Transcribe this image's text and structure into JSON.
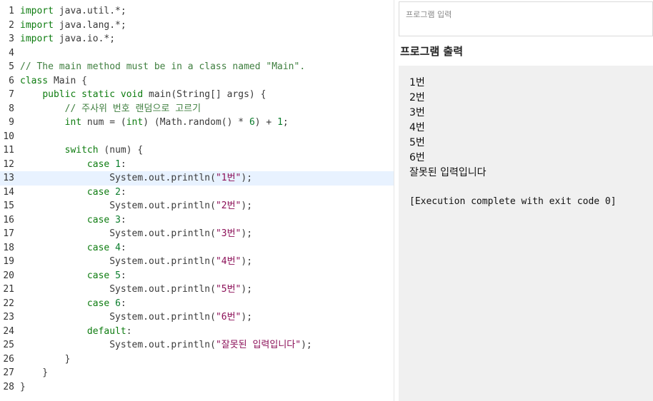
{
  "editor": {
    "active_line": 13,
    "lines": [
      {
        "n": "1",
        "tokens": [
          {
            "t": "kw",
            "v": "import"
          },
          {
            "t": "p",
            "v": " java.util.*;"
          }
        ]
      },
      {
        "n": "2",
        "tokens": [
          {
            "t": "kw",
            "v": "import"
          },
          {
            "t": "p",
            "v": " java.lang.*;"
          }
        ]
      },
      {
        "n": "3",
        "tokens": [
          {
            "t": "kw",
            "v": "import"
          },
          {
            "t": "p",
            "v": " java.io.*;"
          }
        ]
      },
      {
        "n": "4",
        "tokens": []
      },
      {
        "n": "5",
        "tokens": [
          {
            "t": "cm",
            "v": "// The main method must be in a class named \"Main\"."
          }
        ]
      },
      {
        "n": "6",
        "tokens": [
          {
            "t": "kw",
            "v": "class"
          },
          {
            "t": "p",
            "v": " Main {"
          }
        ]
      },
      {
        "n": "7",
        "tokens": [
          {
            "t": "p",
            "v": "    "
          },
          {
            "t": "kw",
            "v": "public static void"
          },
          {
            "t": "p",
            "v": " main(String[] args) {"
          }
        ]
      },
      {
        "n": "8",
        "tokens": [
          {
            "t": "p",
            "v": "        "
          },
          {
            "t": "cm",
            "v": "// 주사위 번호 랜덤으로 고르기"
          }
        ]
      },
      {
        "n": "9",
        "tokens": [
          {
            "t": "p",
            "v": "        "
          },
          {
            "t": "kw",
            "v": "int"
          },
          {
            "t": "p",
            "v": " num = ("
          },
          {
            "t": "kw",
            "v": "int"
          },
          {
            "t": "p",
            "v": ") (Math.random() * "
          },
          {
            "t": "num",
            "v": "6"
          },
          {
            "t": "p",
            "v": ") + "
          },
          {
            "t": "num",
            "v": "1"
          },
          {
            "t": "p",
            "v": ";"
          }
        ]
      },
      {
        "n": "10",
        "tokens": []
      },
      {
        "n": "11",
        "tokens": [
          {
            "t": "p",
            "v": "        "
          },
          {
            "t": "kw",
            "v": "switch"
          },
          {
            "t": "p",
            "v": " (num) {"
          }
        ]
      },
      {
        "n": "12",
        "tokens": [
          {
            "t": "p",
            "v": "            "
          },
          {
            "t": "kw",
            "v": "case"
          },
          {
            "t": "p",
            "v": " "
          },
          {
            "t": "num",
            "v": "1"
          },
          {
            "t": "p",
            "v": ":"
          }
        ]
      },
      {
        "n": "13",
        "tokens": [
          {
            "t": "p",
            "v": "                System.out.println("
          },
          {
            "t": "str",
            "v": "\"1번\""
          },
          {
            "t": "p",
            "v": ");"
          }
        ]
      },
      {
        "n": "14",
        "tokens": [
          {
            "t": "p",
            "v": "            "
          },
          {
            "t": "kw",
            "v": "case"
          },
          {
            "t": "p",
            "v": " "
          },
          {
            "t": "num",
            "v": "2"
          },
          {
            "t": "p",
            "v": ":"
          }
        ]
      },
      {
        "n": "15",
        "tokens": [
          {
            "t": "p",
            "v": "                System.out.println("
          },
          {
            "t": "str",
            "v": "\"2번\""
          },
          {
            "t": "p",
            "v": ");"
          }
        ]
      },
      {
        "n": "16",
        "tokens": [
          {
            "t": "p",
            "v": "            "
          },
          {
            "t": "kw",
            "v": "case"
          },
          {
            "t": "p",
            "v": " "
          },
          {
            "t": "num",
            "v": "3"
          },
          {
            "t": "p",
            "v": ":"
          }
        ]
      },
      {
        "n": "17",
        "tokens": [
          {
            "t": "p",
            "v": "                System.out.println("
          },
          {
            "t": "str",
            "v": "\"3번\""
          },
          {
            "t": "p",
            "v": ");"
          }
        ]
      },
      {
        "n": "18",
        "tokens": [
          {
            "t": "p",
            "v": "            "
          },
          {
            "t": "kw",
            "v": "case"
          },
          {
            "t": "p",
            "v": " "
          },
          {
            "t": "num",
            "v": "4"
          },
          {
            "t": "p",
            "v": ":"
          }
        ]
      },
      {
        "n": "19",
        "tokens": [
          {
            "t": "p",
            "v": "                System.out.println("
          },
          {
            "t": "str",
            "v": "\"4번\""
          },
          {
            "t": "p",
            "v": ");"
          }
        ]
      },
      {
        "n": "20",
        "tokens": [
          {
            "t": "p",
            "v": "            "
          },
          {
            "t": "kw",
            "v": "case"
          },
          {
            "t": "p",
            "v": " "
          },
          {
            "t": "num",
            "v": "5"
          },
          {
            "t": "p",
            "v": ":"
          }
        ]
      },
      {
        "n": "21",
        "tokens": [
          {
            "t": "p",
            "v": "                System.out.println("
          },
          {
            "t": "str",
            "v": "\"5번\""
          },
          {
            "t": "p",
            "v": ");"
          }
        ]
      },
      {
        "n": "22",
        "tokens": [
          {
            "t": "p",
            "v": "            "
          },
          {
            "t": "kw",
            "v": "case"
          },
          {
            "t": "p",
            "v": " "
          },
          {
            "t": "num",
            "v": "6"
          },
          {
            "t": "p",
            "v": ":"
          }
        ]
      },
      {
        "n": "23",
        "tokens": [
          {
            "t": "p",
            "v": "                System.out.println("
          },
          {
            "t": "str",
            "v": "\"6번\""
          },
          {
            "t": "p",
            "v": ");"
          }
        ]
      },
      {
        "n": "24",
        "tokens": [
          {
            "t": "p",
            "v": "            "
          },
          {
            "t": "kw",
            "v": "default"
          },
          {
            "t": "p",
            "v": ":"
          }
        ]
      },
      {
        "n": "25",
        "tokens": [
          {
            "t": "p",
            "v": "                System.out.println("
          },
          {
            "t": "str",
            "v": "\"잘못된 입력입니다\""
          },
          {
            "t": "p",
            "v": ");"
          }
        ]
      },
      {
        "n": "26",
        "tokens": [
          {
            "t": "p",
            "v": "        }"
          }
        ]
      },
      {
        "n": "27",
        "tokens": [
          {
            "t": "p",
            "v": "    }"
          }
        ]
      },
      {
        "n": "28",
        "tokens": [
          {
            "t": "p",
            "v": "}"
          }
        ]
      }
    ]
  },
  "input": {
    "placeholder": "프로그램 입력"
  },
  "output": {
    "title": "프로그램 출력",
    "lines": [
      "1번",
      "2번",
      "3번",
      "4번",
      "5번",
      "6번",
      "잘못된 입력입니다"
    ],
    "exec_status": "[Execution complete with exit code 0]"
  }
}
